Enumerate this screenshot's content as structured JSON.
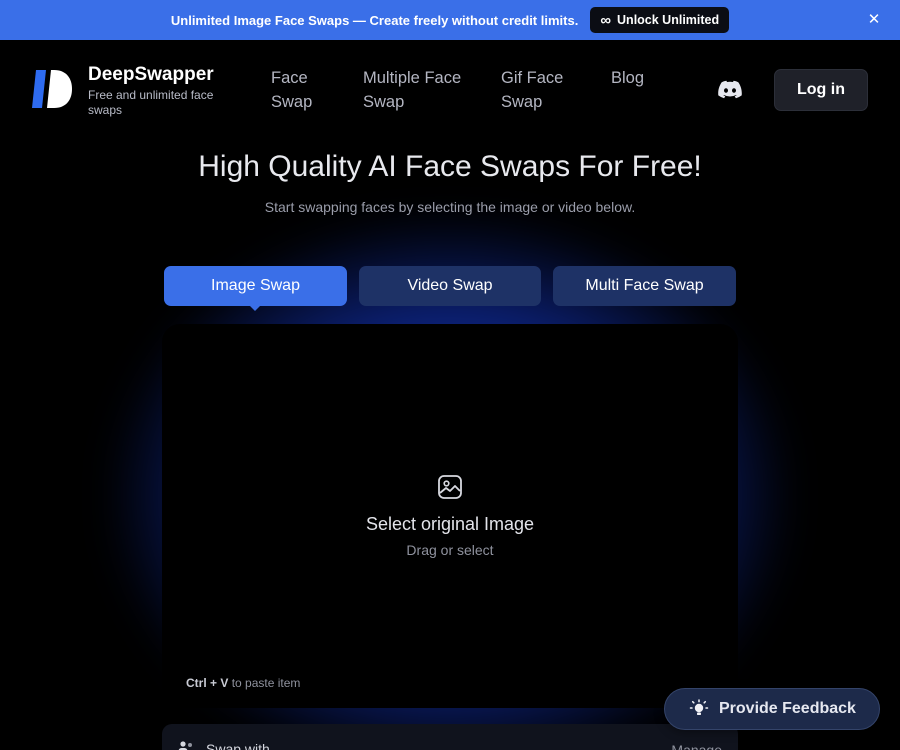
{
  "banner": {
    "text": "Unlimited Image Face Swaps — Create freely without credit limits.",
    "cta_icon": "∞",
    "cta_label": "Unlock Unlimited",
    "close_icon": "✕"
  },
  "header": {
    "brand_name": "DeepSwapper",
    "brand_tagline": "Free and unlimited face swaps",
    "nav": [
      {
        "label": "Face Swap"
      },
      {
        "label": "Multiple Face Swap"
      },
      {
        "label": "Gif Face Swap"
      },
      {
        "label": "Blog"
      }
    ],
    "login_label": "Log in"
  },
  "hero": {
    "title": "High Quality AI Face Swaps For Free!",
    "subtitle": "Start swapping faces by selecting the image or video below."
  },
  "tabs": [
    {
      "label": "Image Swap",
      "active": true
    },
    {
      "label": "Video Swap",
      "active": false
    },
    {
      "label": "Multi Face Swap",
      "active": false
    }
  ],
  "upload": {
    "title": "Select original Image",
    "hint": "Drag or select",
    "paste_keys": "Ctrl + V",
    "paste_text": "to paste item"
  },
  "swap_row": {
    "label": "Swap with",
    "manage": "Manage"
  },
  "feedback": {
    "label": "Provide Feedback"
  },
  "colors": {
    "accent": "#3a6fe8",
    "tab_inactive": "#1e3266",
    "background": "#000000"
  }
}
